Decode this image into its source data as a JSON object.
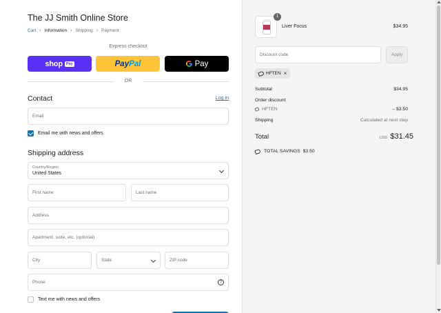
{
  "store": {
    "title": "The JJ Smith Online Store"
  },
  "breadcrumb": {
    "cart": "Cart",
    "information": "Information",
    "shipping": "Shipping",
    "payment": "Payment",
    "separator": "›"
  },
  "express": {
    "label": "Express checkout",
    "shoppay": "shop",
    "shoppay_badge": "Pay",
    "paypal_1": "Pay",
    "paypal_2": "Pal",
    "gpay_g": "G",
    "gpay": "Pay",
    "or": "OR"
  },
  "contact": {
    "heading": "Contact",
    "login": "Log in",
    "email_placeholder": "Email",
    "newsletter": "Email me with news and offers",
    "newsletter_checked": true
  },
  "shipping": {
    "heading": "Shipping address",
    "country_label": "Country/Region",
    "country_value": "United States",
    "first_name": "First name",
    "last_name": "Last name",
    "address": "Address",
    "apartment": "Apartment, suite, etc. (optional)",
    "city": "City",
    "state": "State",
    "zip": "ZIP code",
    "phone": "Phone",
    "help": "?",
    "text_offers": "Text me with news and offers",
    "text_offers_checked": false
  },
  "order": {
    "product": {
      "name": "Liver Focus",
      "price": "$34.95",
      "quantity": "1"
    },
    "discount_placeholder": "Discount code",
    "apply": "Apply",
    "applied_code": "HFTEN",
    "remove_icon": "×",
    "subtotal_label": "Subtotal",
    "subtotal": "$34.95",
    "order_discount_label": "Order discount",
    "discount_code": "HFTEN",
    "discount_amount": "– $3.50",
    "shipping_label": "Shipping",
    "shipping_value": "Calculated at next step",
    "total_label": "Total",
    "currency": "USD",
    "total": "$31.45",
    "savings_label": "TOTAL SAVINGS",
    "savings": "$3.50"
  },
  "colors": {
    "link": "#1773b0",
    "shoppay": "#5a31f4",
    "paypal": "#ffc439",
    "gpay": "#000000",
    "summary_bg": "#f5f5f5"
  }
}
